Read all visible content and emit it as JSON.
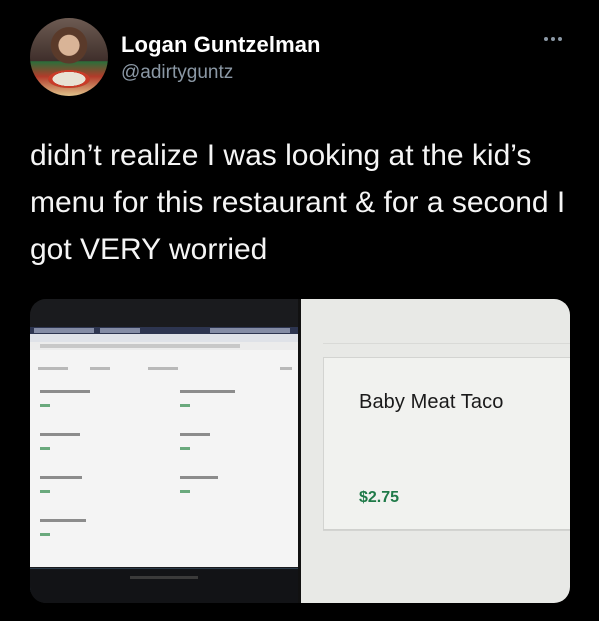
{
  "user": {
    "display_name": "Logan Guntzelman",
    "handle": "@adirtyguntz"
  },
  "tweet": {
    "text": "didn’t realize I was looking at the kid’s menu for this restaurant & for a second I got VERY worried"
  },
  "media": {
    "zoom_item_name": "Baby Meat Taco",
    "zoom_item_price": "$2.75"
  },
  "icons": {
    "more": "more-horizontal-icon"
  }
}
